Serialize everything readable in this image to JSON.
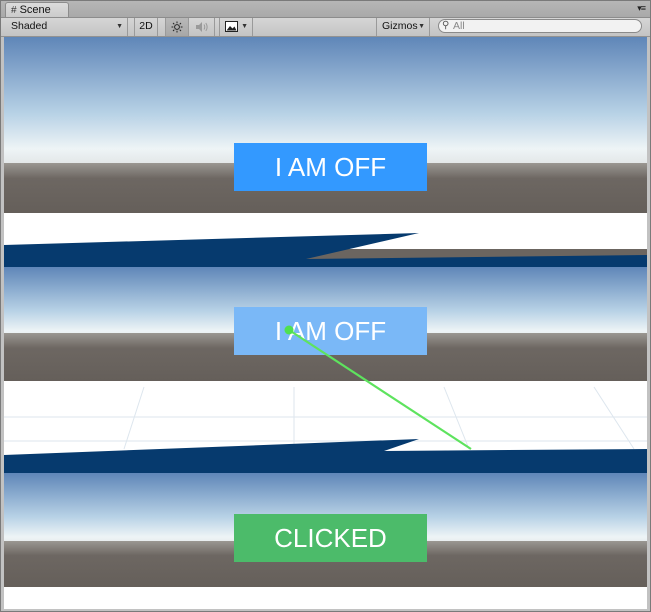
{
  "window": {
    "tab_label": "Scene",
    "tab_icon": "grid-icon"
  },
  "toolbar": {
    "draw_mode": "Shaded",
    "mode_2d": "2D",
    "lighting_icon": "sun-icon",
    "audio_icon": "speaker-icon",
    "effects_icon": "image-icon",
    "gizmos_label": "Gizmos",
    "search_placeholder": "All"
  },
  "scene": {
    "buttons": [
      {
        "label": "I AM OFF",
        "color": "#3399ff"
      },
      {
        "label": "I AM OFF",
        "color": "#7ab8f7"
      },
      {
        "label": "CLICKED",
        "color": "#4cbb6a"
      }
    ],
    "pointer_ray_color": "#5ee35e",
    "stripe_color": "#063a6e"
  }
}
